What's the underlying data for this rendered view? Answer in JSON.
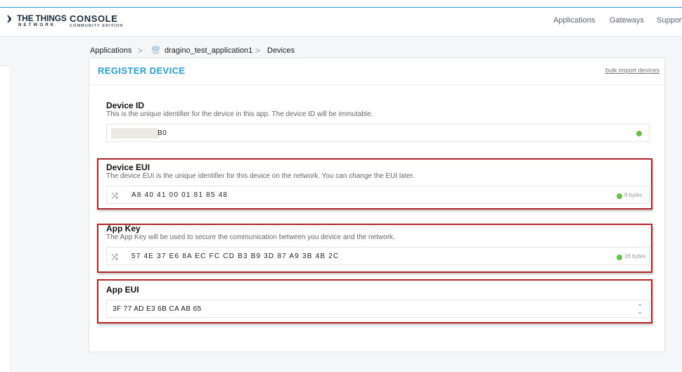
{
  "header": {
    "logo_the_things": "THE THINGS",
    "logo_network": "NETWORK",
    "logo_console": "CONSOLE",
    "logo_edition": "COMMUNITY EDITION",
    "nav": [
      "Applications",
      "Gateways",
      "Support"
    ]
  },
  "breadcrumb": {
    "items": [
      "Applications",
      "dragino_test_application1",
      "Devices"
    ],
    "separator": ">"
  },
  "form": {
    "title": "REGISTER DEVICE",
    "bulk_import": "bulk import devices",
    "device_id": {
      "label": "Device ID",
      "description": "This is the unique identifier for the device in this app. The device ID will be immutable.",
      "value_visible": "B0"
    },
    "device_eui": {
      "label": "Device EUI",
      "description": "The device EUI is the unique identifier for this device on the network. You can change the EUI later.",
      "value": "A8 40 41 00 01 81 85 48",
      "size": "8 bytes"
    },
    "app_key": {
      "label": "App Key",
      "description": "The App Key will be used to secure the communication between you device and the network.",
      "value": "57 4E 37 E6 8A EC FC CD B3 B9 3D 87 A9 3B 4B 2C",
      "size": "16 bytes"
    },
    "app_eui": {
      "label": "App EUI",
      "selected": "3F 77 AD E3 6B CA AB 65"
    }
  },
  "colors": {
    "accent": "#2a9fd6",
    "highlight_box": "#b0262b",
    "valid_dot": "#6cc04a"
  }
}
